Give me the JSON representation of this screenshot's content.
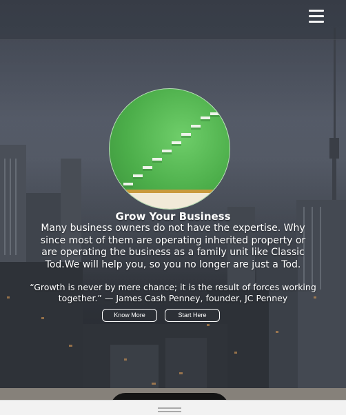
{
  "header": {
    "menu_icon": "hamburger-menu-icon"
  },
  "hero": {
    "image_icon": "green-staircase-image",
    "title": "Grow Your Business",
    "body": "Many business owners do not have the expertise. Why since most of them are operating inherited property or are operating the business as a family unit like Classic Tod.We will help you, so you no longer are just a Tod.",
    "quote": "“Growth is never by mere chance; it is the result of forces working together.” — James Cash Penney, founder, JC Penney",
    "buttons": {
      "know_more": "Know More",
      "start_here": "Start Here"
    }
  },
  "bottom_bar": {
    "handle_icon": "drag-handle-icon"
  },
  "colors": {
    "accent_green": "#4cae4a",
    "text": "#ffffff",
    "footer_strip": "#86817a"
  }
}
